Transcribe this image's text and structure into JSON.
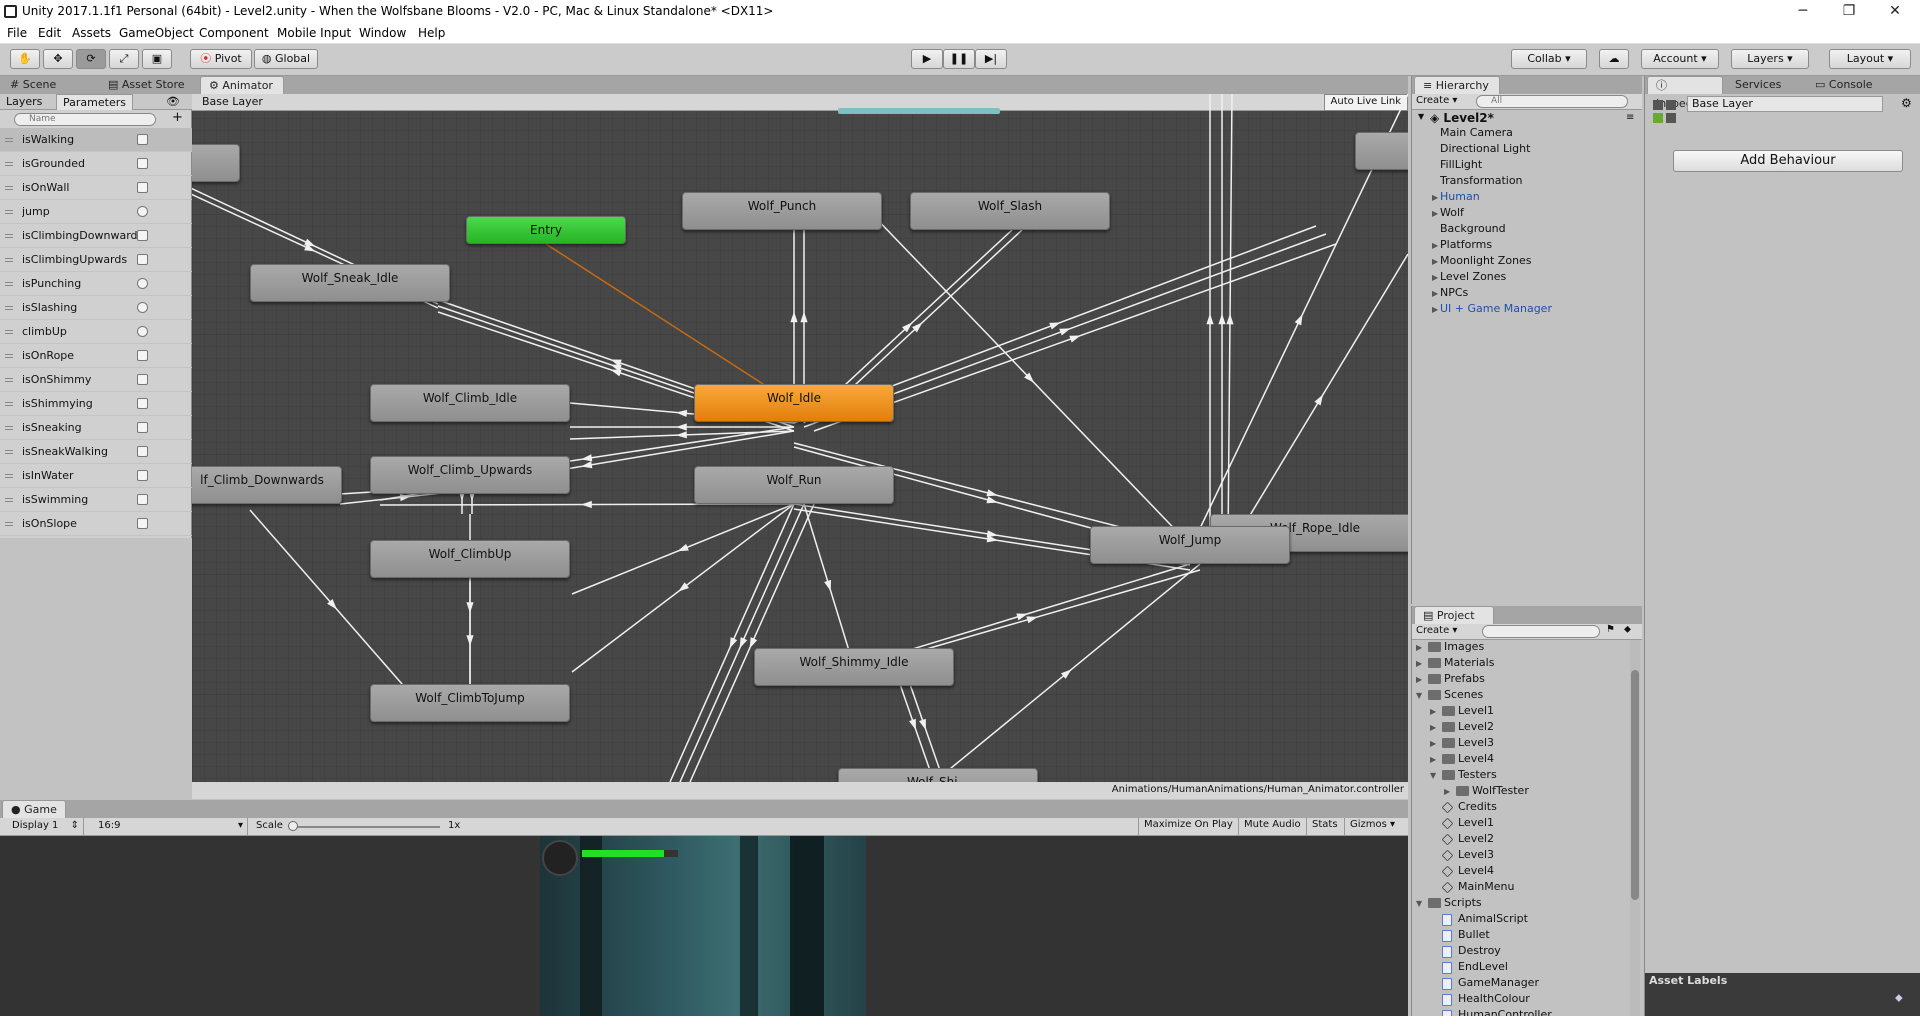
{
  "window": {
    "title": "Unity 2017.1.1f1 Personal (64bit) - Level2.unity - When the Wolfsbane Blooms - V2.0 - PC, Mac & Linux Standalone* <DX11>",
    "controls": {
      "minimize": "─",
      "maximize": "❐",
      "close": "✕"
    }
  },
  "menu": [
    "File",
    "Edit",
    "Assets",
    "GameObject",
    "Component",
    "Mobile Input",
    "Window",
    "Help"
  ],
  "toolbar": {
    "pivot": "Pivot",
    "global": "Global",
    "collab": "Collab",
    "account": "Account",
    "layers": "Layers",
    "layout": "Layout"
  },
  "animator_tabs": {
    "scene": "Scene",
    "asset_store": "Asset Store",
    "animator": "Animator"
  },
  "params_panel": {
    "tab_layers": "Layers",
    "tab_parameters": "Parameters",
    "search_placeholder": "Name",
    "add": "+",
    "parameters": [
      {
        "name": "isWalking",
        "type": "bool"
      },
      {
        "name": "isGrounded",
        "type": "bool"
      },
      {
        "name": "isOnWall",
        "type": "bool"
      },
      {
        "name": "jump",
        "type": "trigger"
      },
      {
        "name": "isClimbingDownwards",
        "type": "bool"
      },
      {
        "name": "isClimbingUpwards",
        "type": "bool"
      },
      {
        "name": "isPunching",
        "type": "trigger"
      },
      {
        "name": "isSlashing",
        "type": "trigger"
      },
      {
        "name": "climbUp",
        "type": "trigger"
      },
      {
        "name": "isOnRope",
        "type": "bool"
      },
      {
        "name": "isOnShimmy",
        "type": "bool"
      },
      {
        "name": "isShimmying",
        "type": "bool"
      },
      {
        "name": "isSneaking",
        "type": "bool"
      },
      {
        "name": "isSneakWalking",
        "type": "bool"
      },
      {
        "name": "isInWater",
        "type": "bool"
      },
      {
        "name": "isSwimming",
        "type": "bool"
      },
      {
        "name": "isOnSlope",
        "type": "bool"
      }
    ]
  },
  "graph": {
    "breadcrumb": "Base Layer",
    "auto_live_link": "Auto Live Link",
    "status_path": "Animations/HumanAnimations/Human_Animator.controller",
    "states": {
      "entry": "Entry",
      "wolf_punch": "Wolf_Punch",
      "wolf_slash": "Wolf_Slash",
      "wolf_sneak_idle": "Wolf_Sneak_Idle",
      "wolf_climb_idle": "Wolf_Climb_Idle",
      "wolf_idle": "Wolf_Idle",
      "wolf_climb_upwards": "Wolf_Climb_Upwards",
      "wolf_climb_downwards": "lf_Climb_Downwards",
      "wolf_run": "Wolf_Run",
      "wolf_climbup": "Wolf_ClimbUp",
      "wolf_jump": "Wolf_Jump",
      "wolf_rope_idle": "Wolf_Rope_Idle",
      "wolf_shimmy_idle": "Wolf_Shimmy_Idle",
      "wolf_climbtojump": "Wolf_ClimbToJump",
      "wolf_shimmy_partial": "Wolf_Shi..."
    }
  },
  "game": {
    "tab": "Game",
    "display": "Display 1",
    "aspect": "16:9",
    "scale_label": "Scale",
    "scale_value": "1x",
    "maximize": "Maximize On Play",
    "mute": "Mute Audio",
    "stats": "Stats",
    "gizmos": "Gizmos",
    "health_fraction": 0.85
  },
  "hierarchy": {
    "tab": "Hierarchy",
    "create": "Create",
    "search_placeholder": "All",
    "scene": "Level2*",
    "items": [
      {
        "label": "Main Camera",
        "expandable": false,
        "blue": false
      },
      {
        "label": "Directional Light",
        "expandable": false,
        "blue": false
      },
      {
        "label": "FillLight",
        "expandable": false,
        "blue": false
      },
      {
        "label": "Transformation",
        "expandable": false,
        "blue": false
      },
      {
        "label": "Human",
        "expandable": true,
        "blue": true
      },
      {
        "label": "Wolf",
        "expandable": true,
        "blue": false
      },
      {
        "label": "Background",
        "expandable": false,
        "blue": false
      },
      {
        "label": "Platforms",
        "expandable": true,
        "blue": false
      },
      {
        "label": "Moonlight Zones",
        "expandable": true,
        "blue": false
      },
      {
        "label": "Level Zones",
        "expandable": true,
        "blue": false
      },
      {
        "label": "NPCs",
        "expandable": true,
        "blue": false
      },
      {
        "label": "UI + Game Manager",
        "expandable": true,
        "blue": true
      }
    ]
  },
  "project": {
    "tab": "Project",
    "create": "Create",
    "items": [
      {
        "label": "Images",
        "kind": "folder",
        "depth": 0,
        "arrow": "right"
      },
      {
        "label": "Materials",
        "kind": "folder",
        "depth": 0,
        "arrow": "right"
      },
      {
        "label": "Prefabs",
        "kind": "folder",
        "depth": 0,
        "arrow": "right"
      },
      {
        "label": "Scenes",
        "kind": "folder",
        "depth": 0,
        "arrow": "down"
      },
      {
        "label": "Level1",
        "kind": "folder",
        "depth": 1,
        "arrow": "right"
      },
      {
        "label": "Level2",
        "kind": "folder",
        "depth": 1,
        "arrow": "right"
      },
      {
        "label": "Level3",
        "kind": "folder",
        "depth": 1,
        "arrow": "right"
      },
      {
        "label": "Level4",
        "kind": "folder",
        "depth": 1,
        "arrow": "right"
      },
      {
        "label": "Testers",
        "kind": "folder",
        "depth": 1,
        "arrow": "down"
      },
      {
        "label": "WolfTester",
        "kind": "folder",
        "depth": 2,
        "arrow": "right"
      },
      {
        "label": "Credits",
        "kind": "scene",
        "depth": 1,
        "arrow": ""
      },
      {
        "label": "Level1",
        "kind": "scene",
        "depth": 1,
        "arrow": ""
      },
      {
        "label": "Level2",
        "kind": "scene",
        "depth": 1,
        "arrow": ""
      },
      {
        "label": "Level3",
        "kind": "scene",
        "depth": 1,
        "arrow": ""
      },
      {
        "label": "Level4",
        "kind": "scene",
        "depth": 1,
        "arrow": ""
      },
      {
        "label": "MainMenu",
        "kind": "scene",
        "depth": 1,
        "arrow": ""
      },
      {
        "label": "Scripts",
        "kind": "folder",
        "depth": 0,
        "arrow": "down"
      },
      {
        "label": "AnimalScript",
        "kind": "script",
        "depth": 1,
        "arrow": ""
      },
      {
        "label": "Bullet",
        "kind": "script",
        "depth": 1,
        "arrow": ""
      },
      {
        "label": "Destroy",
        "kind": "script",
        "depth": 1,
        "arrow": ""
      },
      {
        "label": "EndLevel",
        "kind": "script",
        "depth": 1,
        "arrow": ""
      },
      {
        "label": "GameManager",
        "kind": "script",
        "depth": 1,
        "arrow": ""
      },
      {
        "label": "HealthColour",
        "kind": "script",
        "depth": 1,
        "arrow": ""
      },
      {
        "label": "HumanController",
        "kind": "script",
        "depth": 1,
        "arrow": ""
      }
    ]
  },
  "inspector": {
    "tab_inspector": "Inspector",
    "tab_services": "Services",
    "tab_console": "Console",
    "name": "Base Layer",
    "add_behaviour": "Add Behaviour",
    "asset_labels": "Asset Labels"
  }
}
